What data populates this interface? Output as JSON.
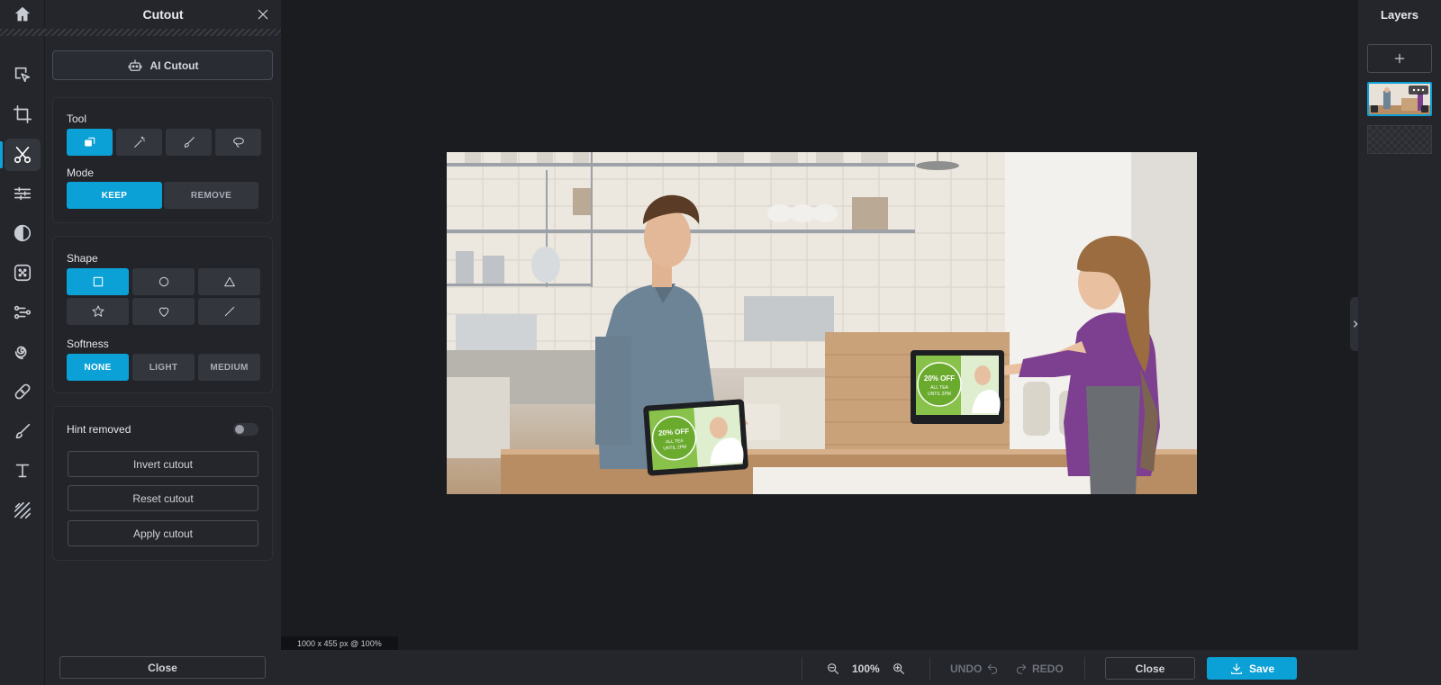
{
  "panel": {
    "title": "Cutout",
    "ai_cutout_label": "AI Cutout",
    "tool_label": "Tool",
    "mode_label": "Mode",
    "mode_options": [
      "KEEP",
      "REMOVE"
    ],
    "shape_label": "Shape",
    "softness_label": "Softness",
    "softness_options": [
      "NONE",
      "LIGHT",
      "MEDIUM"
    ],
    "hint_removed_label": "Hint removed",
    "hint_removed_on": false,
    "invert_label": "Invert cutout",
    "reset_label": "Reset cutout",
    "apply_label": "Apply cutout",
    "close_label": "Close"
  },
  "canvas": {
    "status": "1000 x 455 px @ 100%"
  },
  "photo": {
    "tablet_left": [
      "20% OFF",
      "ALL TEA",
      "UNTIL 2PM"
    ],
    "tablet_right": [
      "20% OFF",
      "ALL TEA",
      "UNTIL 2PM"
    ]
  },
  "layers": {
    "title": "Layers"
  },
  "bottombar": {
    "zoom": "100%",
    "undo_label": "UNDO",
    "redo_label": "REDO",
    "close_label": "Close",
    "save_label": "Save"
  },
  "colors": {
    "accent": "#0ba0d6",
    "background": "#1b1c20",
    "panel": "#24262c"
  }
}
